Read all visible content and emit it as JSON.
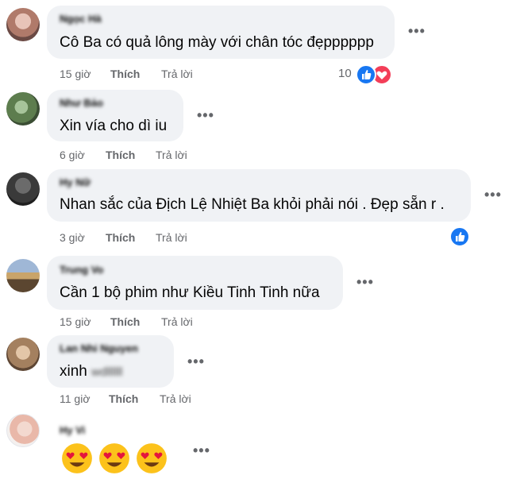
{
  "comments": [
    {
      "author": "Ngọc Hà",
      "text": "Cô Ba có quả lông mày với chân tóc đẹpppppp",
      "time": "15 giờ",
      "like_label": "Thích",
      "reply_label": "Trả lời",
      "reaction_count": "10",
      "reactions": [
        "like-icon",
        "love-icon"
      ]
    },
    {
      "author": "Như Bảo",
      "text": "Xin vía cho dì iu",
      "time": "6 giờ",
      "like_label": "Thích",
      "reply_label": "Trả lời"
    },
    {
      "author": "Hy Nữ",
      "text": "Nhan sắc của Địch Lệ Nhiệt Ba khỏi phải nói . Đẹp sẵn r .",
      "time": "3 giờ",
      "like_label": "Thích",
      "reply_label": "Trả lời",
      "reactions": [
        "like-icon"
      ]
    },
    {
      "author": "Trung Vo",
      "text": "Cần 1 bộ phim như Kiều Tinh Tinh nữa",
      "time": "15 giờ",
      "like_label": "Thích",
      "reply_label": "Trả lời"
    },
    {
      "author": "Lan Nhi Nguyen",
      "text": "xinh",
      "text_blurred": "wdllllll",
      "time": "11 giờ",
      "like_label": "Thích",
      "reply_label": "Trả lời"
    },
    {
      "author": "Hy Vi",
      "emojis": [
        "heart-eyes-emoji",
        "heart-eyes-emoji",
        "heart-eyes-emoji"
      ]
    }
  ],
  "colors": {
    "bubble": "#f0f2f5",
    "meta_text": "#65676b",
    "like_blue": "#1877f2",
    "love_red": "#f33e58"
  }
}
